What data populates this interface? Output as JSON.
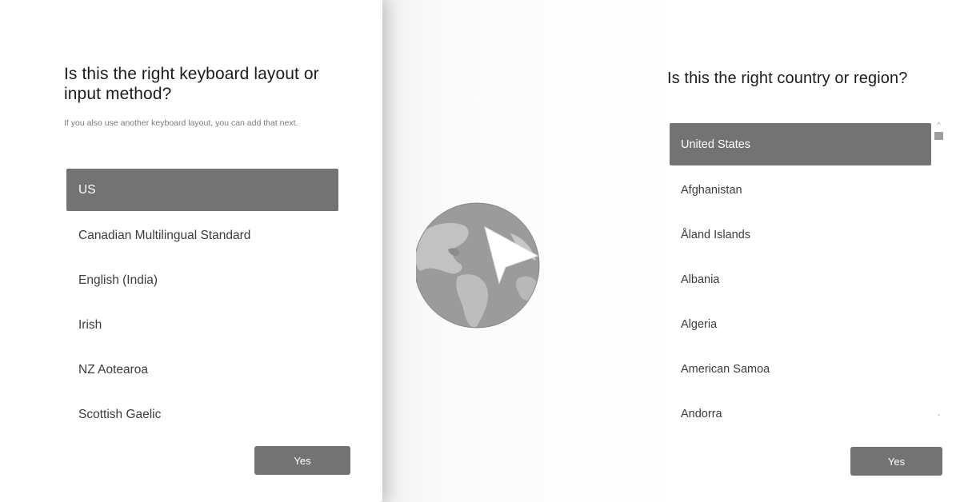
{
  "keyboard_panel": {
    "title": "Is this the right keyboard layout or input method?",
    "subtitle": "If you also use another keyboard layout, you can add that next.",
    "layouts": [
      {
        "label": "US",
        "selected": true
      },
      {
        "label": "Canadian Multilingual Standard",
        "selected": false
      },
      {
        "label": "English (India)",
        "selected": false
      },
      {
        "label": "Irish",
        "selected": false
      },
      {
        "label": "NZ Aotearoa",
        "selected": false
      },
      {
        "label": "Scottish Gaelic",
        "selected": false
      }
    ],
    "yes_label": "Yes"
  },
  "region_panel": {
    "title": "Is this the right country or region?",
    "countries": [
      {
        "label": "United States",
        "selected": true
      },
      {
        "label": "Afghanistan",
        "selected": false
      },
      {
        "label": "Åland Islands",
        "selected": false
      },
      {
        "label": "Albania",
        "selected": false
      },
      {
        "label": "Algeria",
        "selected": false
      },
      {
        "label": "American Samoa",
        "selected": false
      },
      {
        "label": "Andorra",
        "selected": false
      }
    ],
    "yes_label": "Yes"
  },
  "icons": {
    "globe": "globe-with-cursor-icon",
    "scroll_up": "chevron-up-icon",
    "scroll_down": "chevron-down-icon"
  },
  "colors": {
    "selected_row": "#737373",
    "button": "#737373",
    "text": "#1f1f1f",
    "muted_text": "#7a7a7a",
    "globe": "#9a9a9a"
  }
}
